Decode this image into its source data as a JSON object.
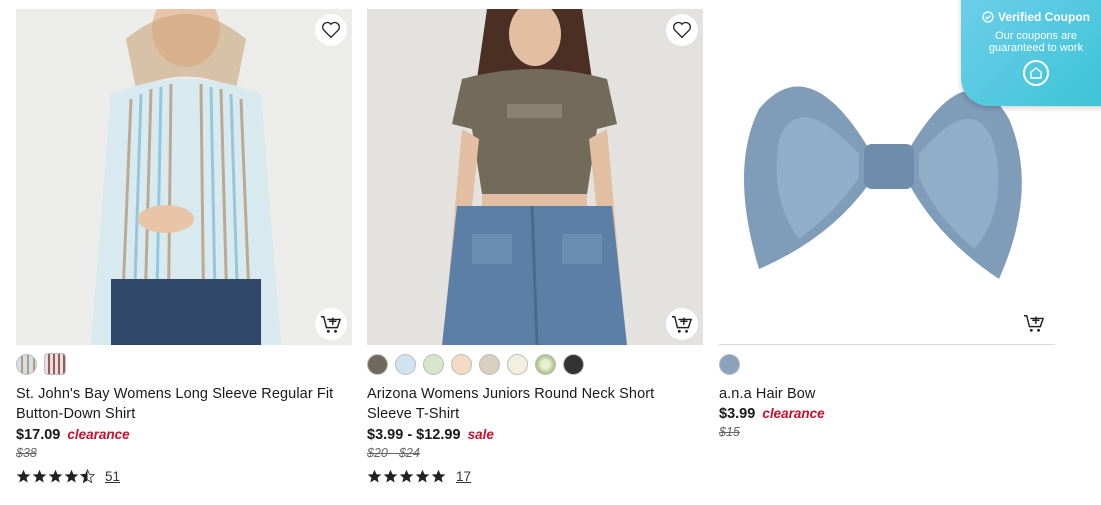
{
  "products": [
    {
      "title": "St. John's Bay Womens Long Sleeve Regular Fit Button-Down Shirt",
      "price": "$17.09",
      "price_tag": "clearance",
      "original_price": "$38",
      "rating": 4.5,
      "review_count": "51",
      "swatches": [
        "#cfe2ea",
        "#9a8a86"
      ]
    },
    {
      "title": "Arizona Womens Juniors Round Neck Short Sleeve T-Shirt",
      "price": "$3.99 - $12.99",
      "price_tag": "sale",
      "original_price": "$20 - $24",
      "rating": 5,
      "review_count": "17",
      "swatches": [
        "#6f6a5e",
        "#cfe3f0",
        "#d6e6c9",
        "#f6dbc4",
        "#d8cfbe",
        "#f4f0e0",
        "#c7d6a9",
        "#333333"
      ]
    },
    {
      "title": "a.n.a Hair Bow",
      "price": "$3.99",
      "price_tag": "clearance",
      "original_price": "$15",
      "swatches": [
        "#8aa2bb"
      ]
    }
  ],
  "coupon": {
    "title": "Verified Coupon",
    "subtitle_line1": "Our coupons are",
    "subtitle_line2": "guaranteed to work"
  },
  "colors": {
    "sale_red": "#c8102e",
    "coupon_teal": "#3cc3d6"
  }
}
